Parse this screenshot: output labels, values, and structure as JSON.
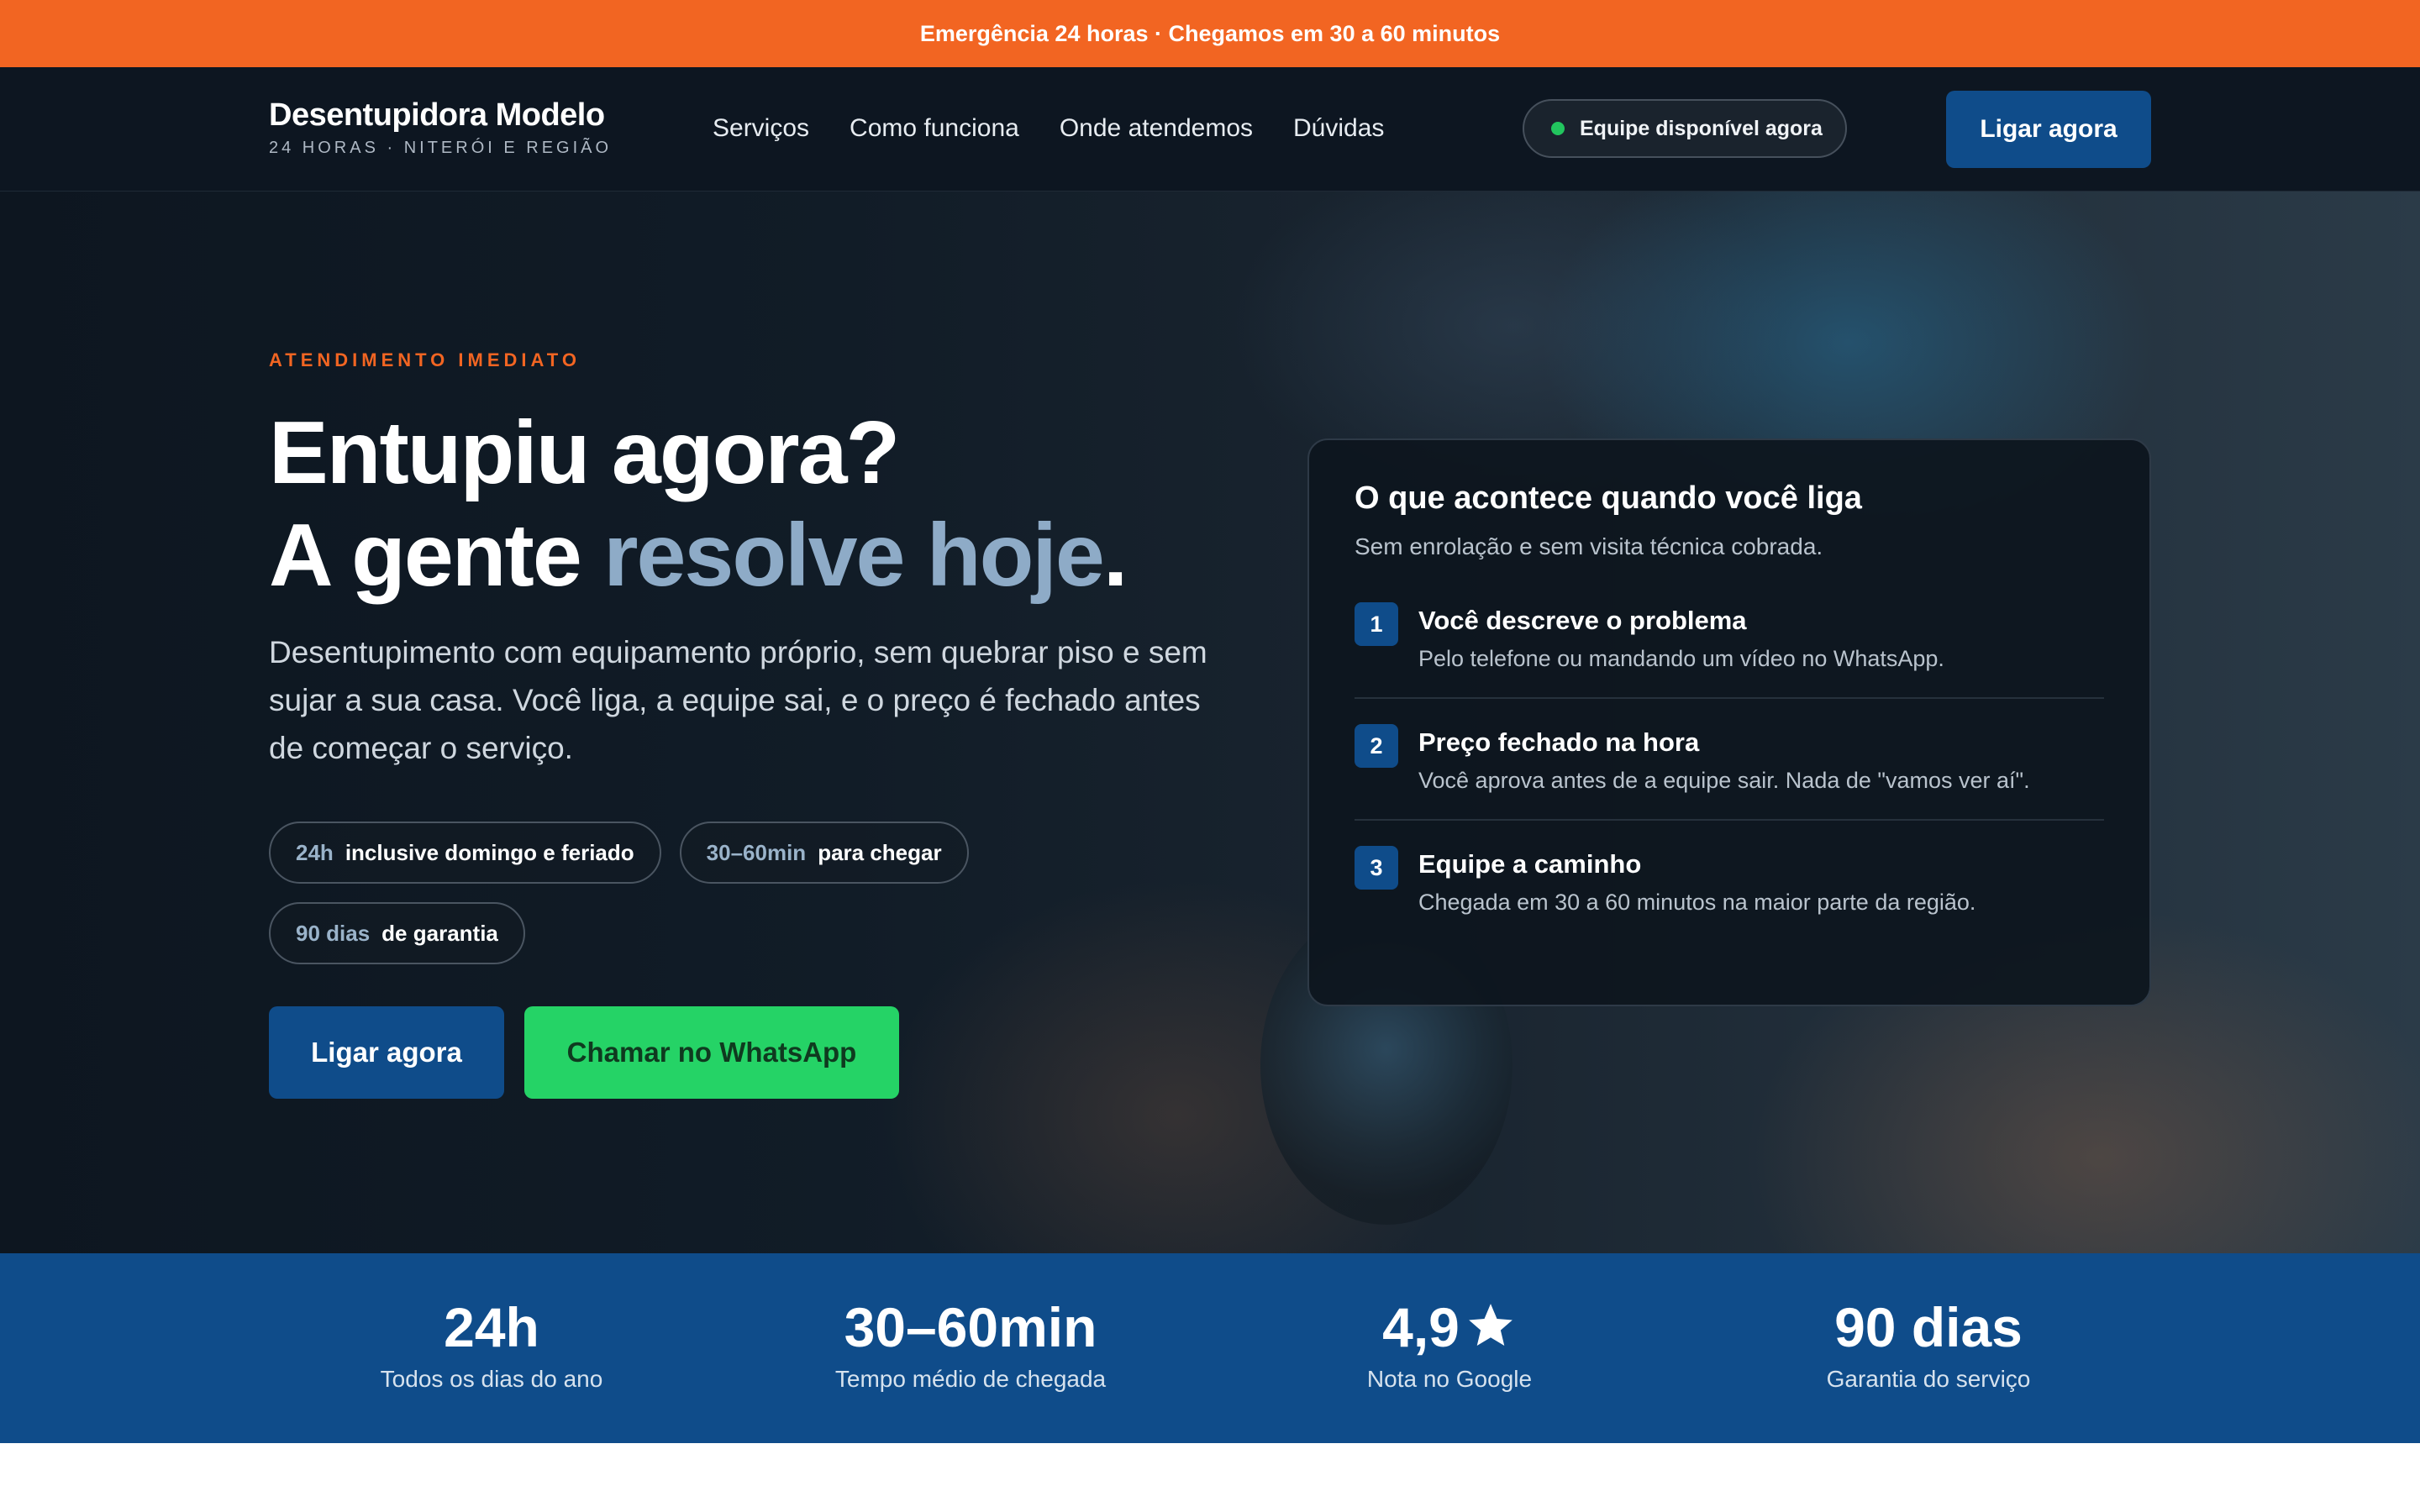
{
  "topbar": {
    "text": "Emergência 24 horas · Chegamos em 30 a 60 minutos"
  },
  "header": {
    "brand_name": "Desentupidora Modelo",
    "brand_sub": "24 HORAS · NITERÓI E REGIÃO",
    "nav": [
      "Serviços",
      "Como funciona",
      "Onde atendemos",
      "Dúvidas"
    ],
    "availability": "Equipe disponível agora",
    "call_label": "Ligar agora"
  },
  "hero": {
    "eyebrow": "ATENDIMENTO IMEDIATO",
    "line1": "Entupiu agora?",
    "line2_a": "A gente ",
    "line2_hl": "resolve hoje",
    "line2_end": ".",
    "lead": "Desentupimento com equipamento próprio, sem quebrar piso e sem sujar a sua casa. Você liga, a equipe sai, e o preço é fechado antes de começar o serviço.",
    "chips": [
      {
        "key": "24h",
        "value": "inclusive domingo e feriado"
      },
      {
        "key": "30–60min",
        "value": "para chegar"
      },
      {
        "key": "90 dias",
        "value": "de garantia"
      }
    ],
    "cta_call": "Ligar agora",
    "cta_whatsapp": "Chamar no WhatsApp"
  },
  "card": {
    "title": "O que acontece quando você liga",
    "subtitle": "Sem enrolação e sem visita técnica cobrada.",
    "steps": [
      {
        "num": "1",
        "title": "Você descreve o problema",
        "desc": "Pelo telefone ou mandando um vídeo no WhatsApp."
      },
      {
        "num": "2",
        "title": "Preço fechado na hora",
        "desc": "Você aprova antes de a equipe sair. Nada de \"vamos ver aí\"."
      },
      {
        "num": "3",
        "title": "Equipe a caminho",
        "desc": "Chegada em 30 a 60 minutos na maior parte da região."
      }
    ]
  },
  "stats": [
    {
      "value": "24h",
      "label": "Todos os dias do ano"
    },
    {
      "value": "30–60min",
      "label": "Tempo médio de chegada"
    },
    {
      "value": "4,9",
      "label": "Nota no Google",
      "icon": "star-icon"
    },
    {
      "value": "90 dias",
      "label": "Garantia do serviço"
    }
  ],
  "colors": {
    "accent_orange": "#f26522",
    "brand_blue": "#0f4c8a",
    "whatsapp_green": "#25d366",
    "dark_bg": "#0d1621",
    "highlight": "#8eabc7"
  }
}
